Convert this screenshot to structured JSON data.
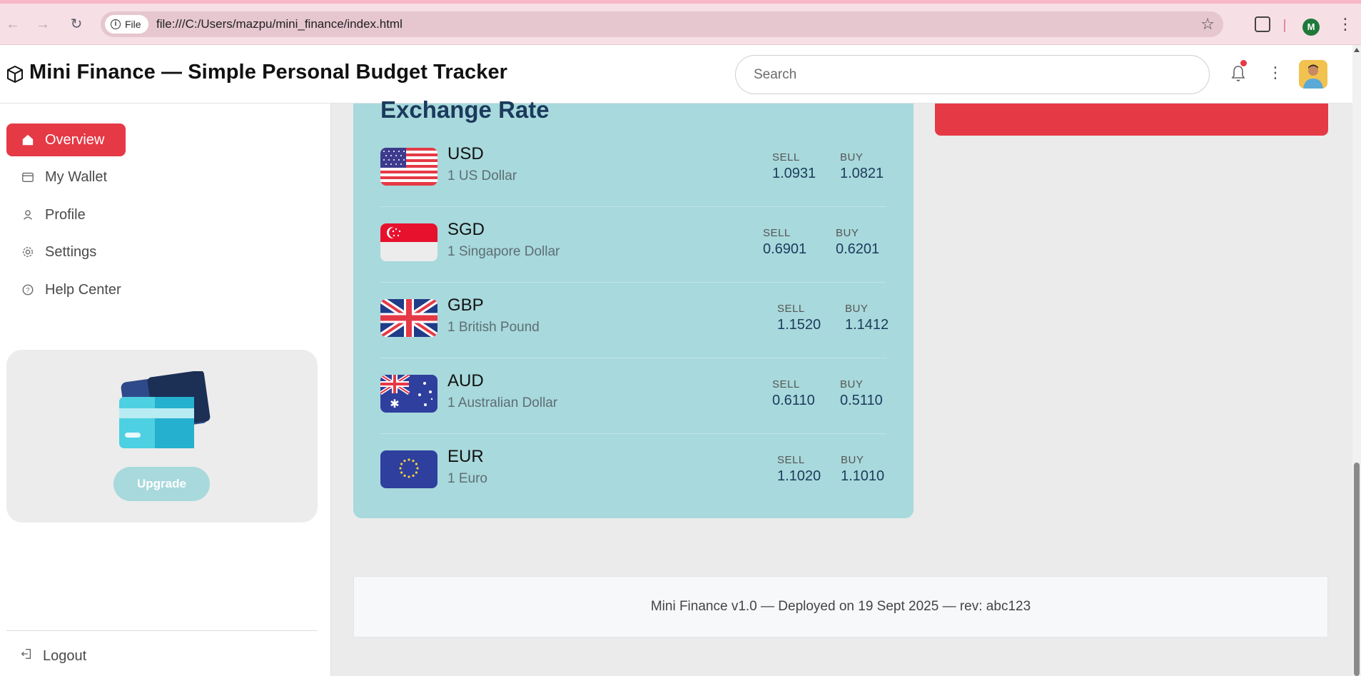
{
  "browser": {
    "file_chip": "File",
    "url": "file:///C:/Users/mazpu/mini_finance/index.html",
    "profile_initial": "M"
  },
  "header": {
    "title": "Mini Finance — Simple Personal Budget Tracker",
    "search_placeholder": "Search"
  },
  "sidebar": {
    "items": [
      {
        "label": "Overview",
        "icon": "home-icon",
        "active": true
      },
      {
        "label": "My Wallet",
        "icon": "wallet-icon"
      },
      {
        "label": "Profile",
        "icon": "user-icon"
      },
      {
        "label": "Settings",
        "icon": "gear-icon"
      },
      {
        "label": "Help Center",
        "icon": "help-icon"
      }
    ],
    "upgrade_label": "Upgrade",
    "logout_label": "Logout"
  },
  "exchange": {
    "title": "Exchange Rate",
    "sell_label": "SELL",
    "buy_label": "BUY",
    "rates": [
      {
        "code": "USD",
        "name": "1 US Dollar",
        "sell": "1.0931",
        "buy": "1.0821"
      },
      {
        "code": "SGD",
        "name": "1 Singapore Dollar",
        "sell": "0.6901",
        "buy": "0.6201"
      },
      {
        "code": "GBP",
        "name": "1 British Pound",
        "sell": "1.1520",
        "buy": "1.1412"
      },
      {
        "code": "AUD",
        "name": "1 Australian Dollar",
        "sell": "0.6110",
        "buy": "0.5110"
      },
      {
        "code": "EUR",
        "name": "1 Euro",
        "sell": "1.1020",
        "buy": "1.1010"
      }
    ]
  },
  "footer": {
    "text": "Mini Finance v1.0 — Deployed on 19 Sept 2025 — rev: abc123"
  },
  "colors": {
    "accent": "#e63946",
    "exchange_bg": "#a8d9dc",
    "upgrade_btn": "#a8d9dc"
  }
}
